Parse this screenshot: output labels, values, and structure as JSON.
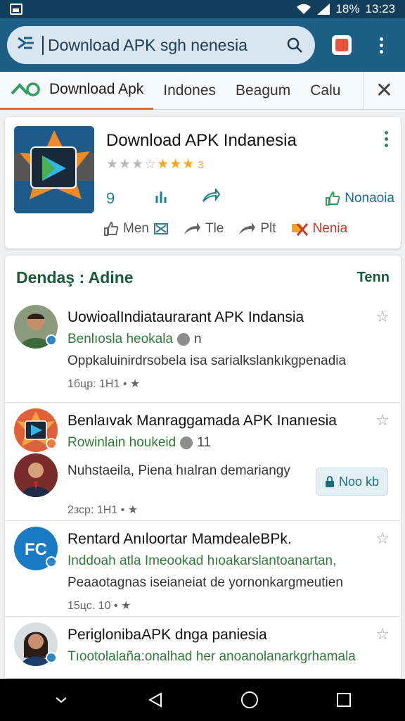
{
  "status_bar": {
    "battery": "18%",
    "time": "13:23",
    "icons": [
      "gallery-icon",
      "wifi-icon",
      "signal-icon"
    ]
  },
  "app_bar": {
    "logo_icon": "app-logo-icon",
    "search_query": "Download APK sgh nenesia",
    "search_icon": "search-icon",
    "action_icon": "bookmark-red-icon",
    "menu_icon": "more-vertical-icon",
    "color": "#1e5f86"
  },
  "tabs": {
    "items": [
      {
        "label": "Download Apk",
        "active": true
      },
      {
        "label": "Indones",
        "active": false
      },
      {
        "label": "Beagum",
        "active": false
      },
      {
        "label": "Calu",
        "active": false
      }
    ],
    "close_icon": "close-icon",
    "accent": "#e36d3b"
  },
  "app_card": {
    "title": "Download APK Indanesia",
    "rating_value": "3",
    "rating_stars": 3,
    "actions": {
      "comment_count": "9",
      "like_label": "ılı",
      "share_label": "",
      "install_label": "Nonaoia"
    },
    "row2": {
      "item1": "Men",
      "item2": "Tle",
      "item3": "Plt",
      "item4": "Nenia"
    }
  },
  "list": {
    "header_title": "Dendaş : Adine",
    "header_link": "Tenn",
    "items": [
      {
        "title": "UowioalIndiataurarant APK Indansia",
        "subtitle": "Benlıosla heokala",
        "meta": "n",
        "desc": "Oppkaluinirdrsobela isa sarialkslankıkgpenadia",
        "time": "1бцр: 1Н1 •"
      },
      {
        "title": "Benlaıvak Manraggamada APK Inanıesia",
        "subtitle": "Rowinlain houkeid",
        "meta": "11",
        "desc": "Nuhstaeila, Piena hıalran demariangy",
        "button": "Noo kb",
        "time": "2зср: 1Н1 •"
      },
      {
        "title": "Rentard Anıloortar MamdealeBPk.",
        "subtitle": "Inddoah atla Imeookad hıoakarslantoanartan,",
        "meta": "",
        "desc": "Peaaotagnas iseianeiat de yornonkargmeutien",
        "time": "15цс. 10 •"
      },
      {
        "title": "PeriglonibaAPK dnga paniesia",
        "subtitle": "Tıootolalaña:onalhad her anoanolanarkgrhamala",
        "meta": "",
        "desc": "",
        "time": ""
      }
    ]
  },
  "nav_bar": {
    "icons": [
      "chevron-down-icon",
      "back-icon",
      "home-icon",
      "recents-icon"
    ]
  }
}
